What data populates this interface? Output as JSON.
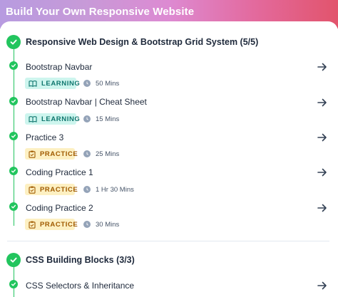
{
  "header": {
    "title": "Build Your Own Responsive Website"
  },
  "sections": [
    {
      "title": "Responsive Web Design & Bootstrap Grid System (5/5)",
      "items": [
        {
          "title": "Bootstrap Navbar",
          "badge": "LEARNING",
          "badge_type": "learning",
          "duration": "50 Mins"
        },
        {
          "title": "Bootstrap Navbar | Cheat Sheet",
          "badge": "LEARNING",
          "badge_type": "learning",
          "duration": "15 Mins"
        },
        {
          "title": "Practice 3",
          "badge": "PRACTICE",
          "badge_type": "practice",
          "duration": "25 Mins"
        },
        {
          "title": "Coding Practice 1",
          "badge": "PRACTICE",
          "badge_type": "practice",
          "duration": "1 Hr 30 Mins"
        },
        {
          "title": "Coding Practice 2",
          "badge": "PRACTICE",
          "badge_type": "practice",
          "duration": "30 Mins"
        }
      ]
    },
    {
      "title": "CSS Building Blocks (3/3)",
      "items": [
        {
          "title": "CSS Selectors & Inheritance"
        }
      ]
    }
  ],
  "colors": {
    "complete": "#22c55e",
    "learning_bg": "#cdf5ee",
    "learning_text": "#0f766e",
    "practice_bg": "#fdf0c2",
    "practice_text": "#a05a00"
  },
  "icons": {
    "section_status": "check-circle-icon",
    "item_status": "check-dot-icon",
    "open_item": "arrow-right-icon",
    "learning_badge": "book-icon",
    "practice_badge": "clipboard-icon",
    "duration": "clock-icon"
  }
}
